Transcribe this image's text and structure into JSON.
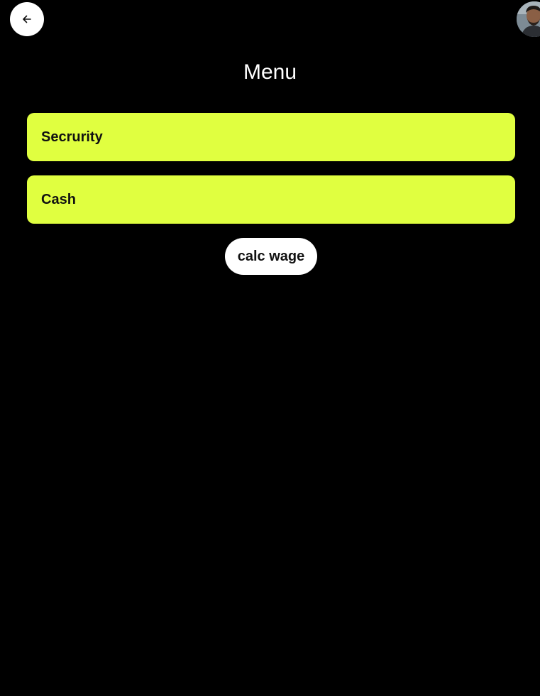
{
  "header": {
    "back_icon": "arrow-left-icon",
    "avatar_icon": "user-avatar"
  },
  "page": {
    "title": "Menu"
  },
  "menu": {
    "items": [
      {
        "label": "Secrurity"
      },
      {
        "label": "Cash"
      }
    ]
  },
  "actions": {
    "calc_label": "calc wage"
  },
  "colors": {
    "background": "#000000",
    "accent": "#e0ff40",
    "button_bg": "#ffffff"
  }
}
